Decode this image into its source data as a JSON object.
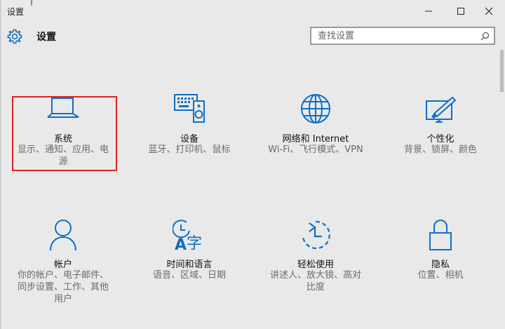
{
  "window": {
    "title": "设置",
    "controls": [
      "minimize-icon",
      "maximize-icon",
      "close-icon"
    ]
  },
  "header": {
    "title": "设置",
    "icon": "gear-icon",
    "search_placeholder": "查找设置",
    "search_icon": "search-icon"
  },
  "accent_color": "#0e6fc7",
  "selection_color": "#e12020",
  "tiles": [
    {
      "name": "系统",
      "desc_lines": [
        "显示、通知、应用、电",
        "源"
      ],
      "icon": "laptop-icon"
    },
    {
      "name": "设备",
      "desc_lines": [
        "蓝牙、打印机、鼠标"
      ],
      "icon": "devices-icon"
    },
    {
      "name": "网络和 Internet",
      "desc_lines": [
        "Wi-Fi、飞行模式、VPN"
      ],
      "icon": "globe-icon"
    },
    {
      "name": "个性化",
      "desc_lines": [
        "背景、锁屏、颜色"
      ],
      "icon": "personalization-icon"
    },
    {
      "name": "帐户",
      "desc_lines": [
        "你的帐户、电子邮件、",
        "同步设置、工作、其他",
        "用户"
      ],
      "icon": "person-icon"
    },
    {
      "name": "时间和语言",
      "desc_lines": [
        "语音、区域、日期"
      ],
      "icon": "time-language-icon"
    },
    {
      "name": "轻松使用",
      "desc_lines": [
        "讲述人、放大镜、高对",
        "比度"
      ],
      "icon": "ease-of-access-icon"
    },
    {
      "name": "隐私",
      "desc_lines": [
        "位置、相机"
      ],
      "icon": "lock-icon"
    }
  ]
}
